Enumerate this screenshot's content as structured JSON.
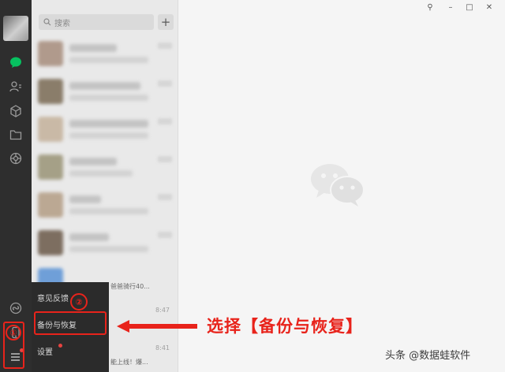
{
  "search": {
    "placeholder": "搜索",
    "add_label": "+"
  },
  "window_controls": {
    "pin": "⚲",
    "minimize": "–",
    "maximize": "□",
    "close": "✕"
  },
  "sidebar": {
    "icons": [
      "chat-icon",
      "contacts-icon",
      "favorites-icon",
      "files-icon",
      "moments-icon",
      "miniprogram-icon",
      "phone-icon",
      "menu-icon"
    ],
    "accent": "#07c160"
  },
  "chat_list": {
    "snippets": [
      {
        "text": "爸爸骑行40...",
        "time": ""
      },
      {
        "text": "",
        "time": "8:47"
      },
      {
        "text": "",
        "time": "8:41"
      },
      {
        "text": "能上线！爆...",
        "time": ""
      }
    ]
  },
  "menu_popup": {
    "items": [
      "意见反馈",
      "备份与恢复",
      "设置"
    ]
  },
  "annotations": {
    "step1": "①",
    "step2": "②",
    "instruction": "选择【备份与恢复】",
    "color": "#e8231b"
  },
  "watermark": "头条 @数据蛙软件"
}
